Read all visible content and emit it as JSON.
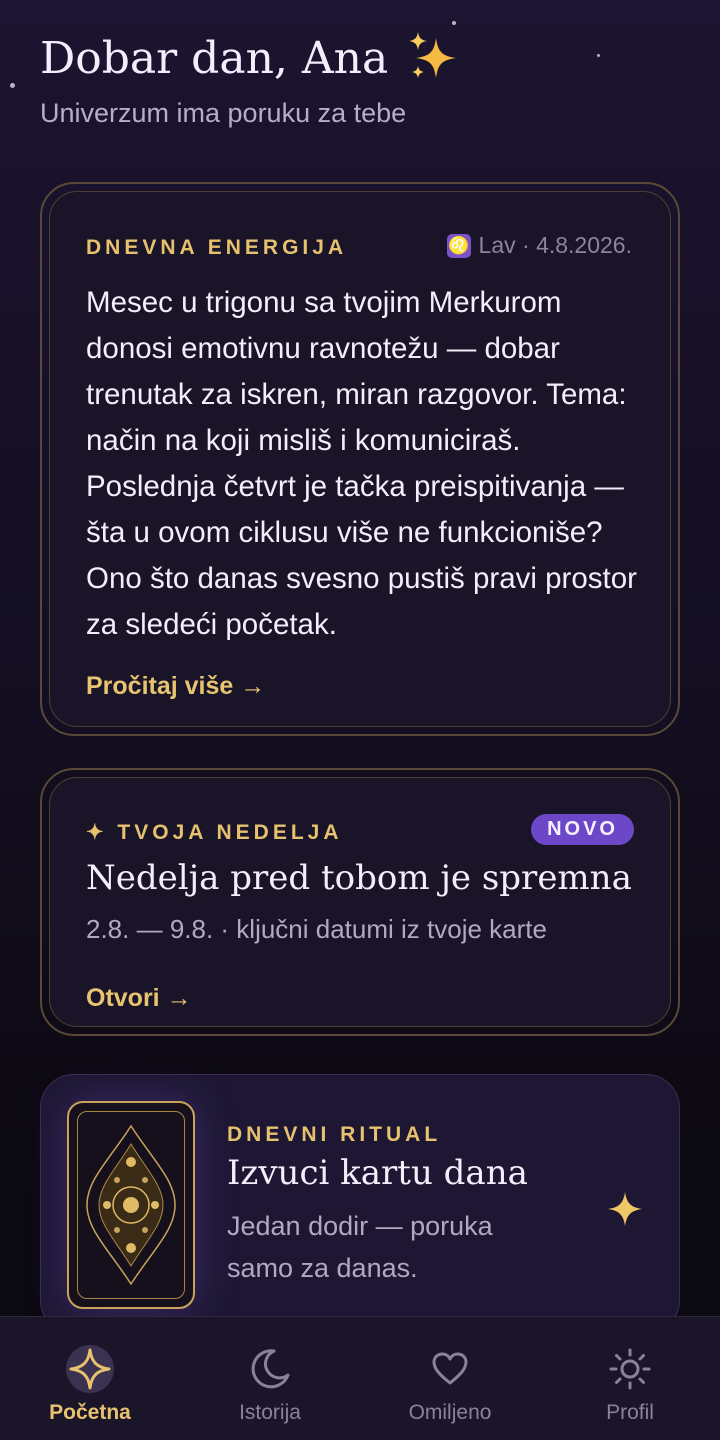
{
  "header": {
    "greeting": "Dobar dan, Ana",
    "subtitle": "Univerzum ima poruku za tebe"
  },
  "daily_energy": {
    "eyebrow": "DNEVNA ENERGIJA",
    "sign_icon": "leo-icon",
    "meta": "Lav · 4.8.2026.",
    "text": "Mesec u trigonu sa tvojim Merkurom donosi emotivnu ravnotežu — dobar trenutak za iskren, miran razgovor. Tema: način na koji misliš i komuniciraš. Poslednja četvrt je tačka preispitivanja — šta u ovom ciklusu više ne funkcioniše? Ono što danas svesno pustiš pravi prostor za sledeći početak.",
    "link": "Pročitaj više →"
  },
  "week": {
    "eyebrow": "✦ TVOJA NEDELJA",
    "badge": "NOVO",
    "title": "Nedelja pred tobom je spremna",
    "subtitle": "2.8. — 9.8. · ključni datumi iz tvoje karte",
    "link": "Otvori →"
  },
  "ritual": {
    "eyebrow": "DNEVNI RITUAL",
    "title": "Izvuci kartu dana",
    "subtitle": "Jedan dodir — poruka samo za danas."
  },
  "nav": {
    "items": [
      {
        "label": "Početna",
        "icon": "sparkle-icon",
        "active": true
      },
      {
        "label": "Istorija",
        "icon": "moon-icon",
        "active": false
      },
      {
        "label": "Omiljeno",
        "icon": "heart-icon",
        "active": false
      },
      {
        "label": "Profil",
        "icon": "sun-icon",
        "active": false
      }
    ]
  },
  "colors": {
    "accent_gold": "#e6c16e",
    "accent_purple": "#6c47c8",
    "background": "#140f22"
  }
}
